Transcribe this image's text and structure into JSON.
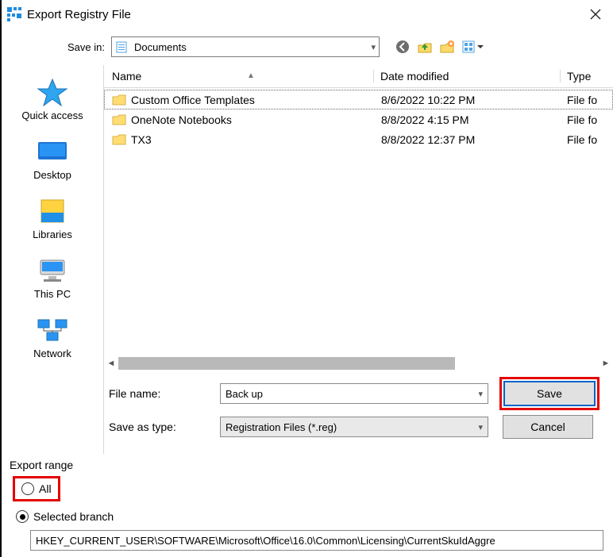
{
  "titlebar": {
    "title": "Export Registry File"
  },
  "savein": {
    "label": "Save in:",
    "selected": "Documents"
  },
  "toolbar_icons": {
    "back": "back-icon",
    "up": "up-folder-icon",
    "newfolder": "new-folder-icon",
    "viewmenu": "view-menu-icon"
  },
  "sidebar": {
    "items": [
      {
        "id": "quick-access",
        "label": "Quick access"
      },
      {
        "id": "desktop",
        "label": "Desktop"
      },
      {
        "id": "libraries",
        "label": "Libraries"
      },
      {
        "id": "this-pc",
        "label": "This PC"
      },
      {
        "id": "network",
        "label": "Network"
      }
    ]
  },
  "columns": {
    "name": "Name",
    "date": "Date modified",
    "type": "Type"
  },
  "files": [
    {
      "name": "Custom Office Templates",
      "date": "8/6/2022 10:22 PM",
      "type": "File fo"
    },
    {
      "name": "OneNote Notebooks",
      "date": "8/8/2022 4:15 PM",
      "type": "File fo"
    },
    {
      "name": "TX3",
      "date": "8/8/2022 12:37 PM",
      "type": "File fo"
    }
  ],
  "form": {
    "filename_label": "File name:",
    "filename_value": "Back up",
    "savetype_label": "Save as type:",
    "savetype_value": "Registration Files (*.reg)",
    "save_label": "Save",
    "cancel_label": "Cancel"
  },
  "export": {
    "legend": "Export range",
    "all_label": "All",
    "selected_label": "Selected branch",
    "branch_value": "HKEY_CURRENT_USER\\SOFTWARE\\Microsoft\\Office\\16.0\\Common\\Licensing\\CurrentSkuIdAggre"
  }
}
